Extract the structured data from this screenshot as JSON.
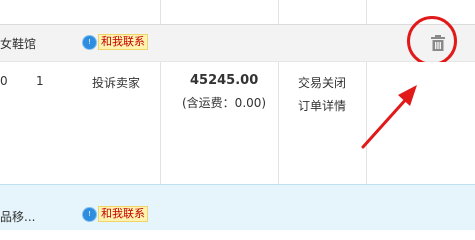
{
  "order1": {
    "shop_name": "女鞋馆",
    "contact_label": "和我联系",
    "contact_bubble": "!",
    "quantity": "1",
    "item_prefix": "0",
    "complaint_link": "投诉卖家",
    "price": "45245.00",
    "shipping_note": "(含运费：0.00)",
    "status": "交易关闭",
    "detail_link": "订单详情"
  },
  "order2": {
    "shop_name": "品移...",
    "contact_label": "和我联系",
    "contact_bubble": "!"
  },
  "annotation": {
    "color": "#e11919"
  },
  "icons": {
    "delete": "trash-icon",
    "contact": "chat-bubble-icon"
  }
}
